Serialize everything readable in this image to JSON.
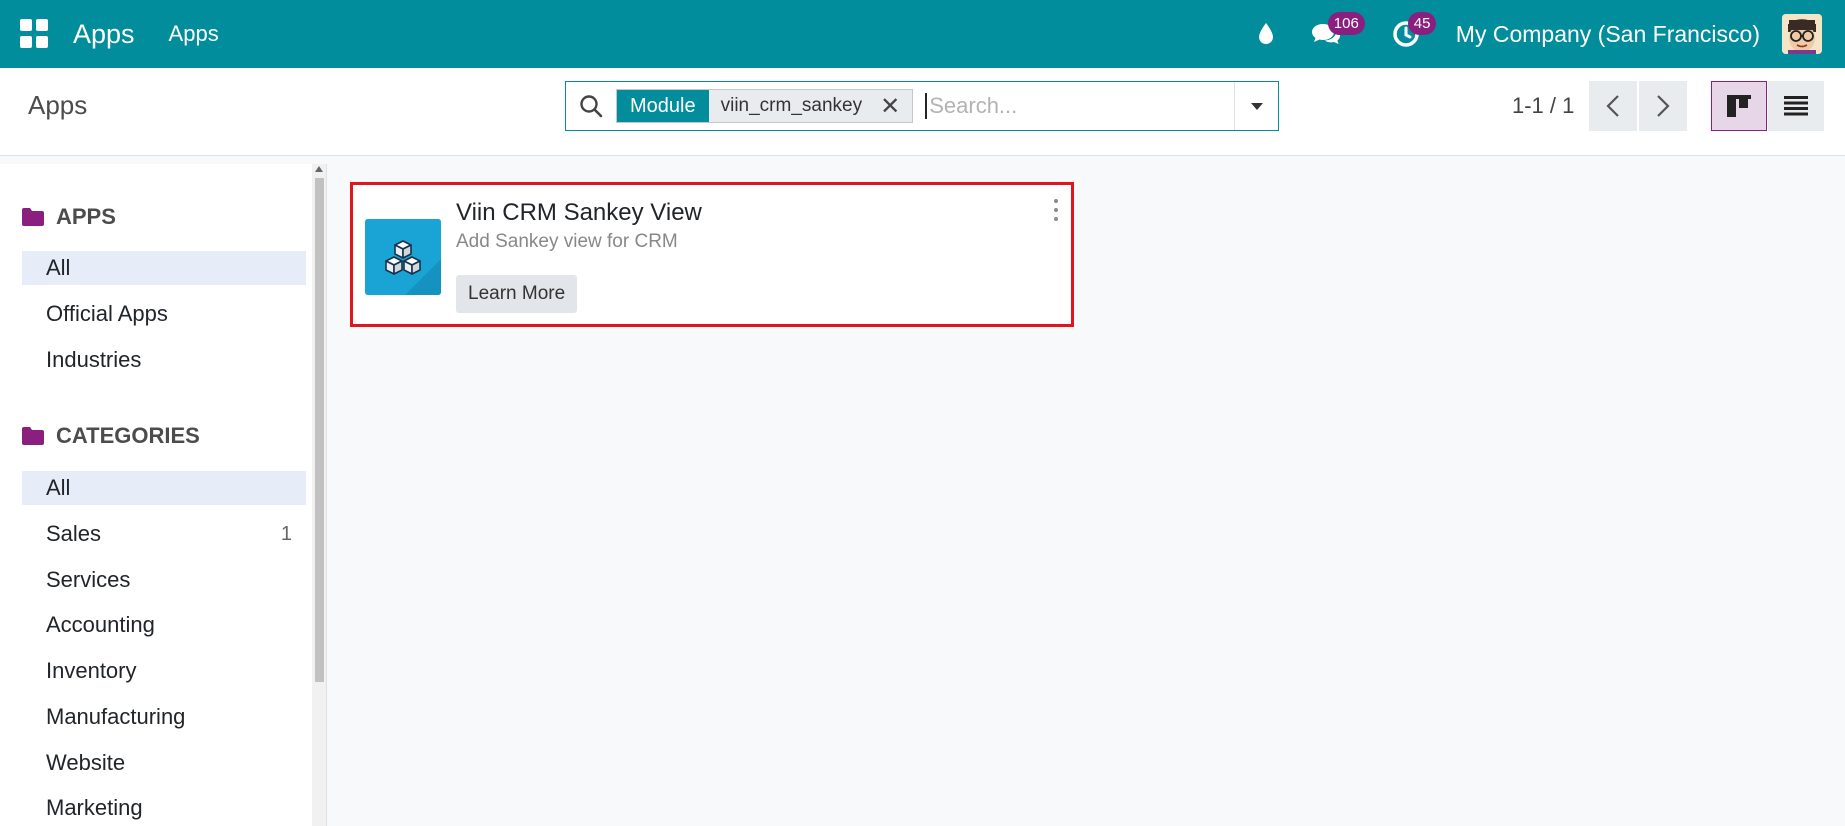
{
  "navbar": {
    "brand": "Apps",
    "menu_item": "Apps",
    "messages_badge": "106",
    "activities_badge": "45",
    "company": "My Company (San Francisco)",
    "color": "#018d9b"
  },
  "control_panel": {
    "title": "Apps",
    "search": {
      "facet_label": "Module",
      "facet_value": "viin_crm_sankey",
      "placeholder": "Search..."
    },
    "pager": "1-1 / 1"
  },
  "sidebar": {
    "apps_section": "APPS",
    "apps_items": [
      {
        "label": "All"
      },
      {
        "label": "Official Apps"
      },
      {
        "label": "Industries"
      }
    ],
    "categories_section": "CATEGORIES",
    "category_items": [
      {
        "label": "All",
        "count": ""
      },
      {
        "label": "Sales",
        "count": "1"
      },
      {
        "label": "Services",
        "count": ""
      },
      {
        "label": "Accounting",
        "count": ""
      },
      {
        "label": "Inventory",
        "count": ""
      },
      {
        "label": "Manufacturing",
        "count": ""
      },
      {
        "label": "Website",
        "count": ""
      },
      {
        "label": "Marketing",
        "count": ""
      }
    ]
  },
  "card": {
    "title": "Viin CRM Sankey View",
    "summary": "Add Sankey view for CRM",
    "button": "Learn More"
  },
  "icons": [
    "apps-grid-icon",
    "drop-icon",
    "chat-icon",
    "clock-icon",
    "search-icon",
    "close-icon",
    "caret-down-icon",
    "chevron-left-icon",
    "chevron-right-icon",
    "kanban-icon",
    "list-icon",
    "folder-icon",
    "cubes-icon",
    "vertical-dots-icon"
  ]
}
